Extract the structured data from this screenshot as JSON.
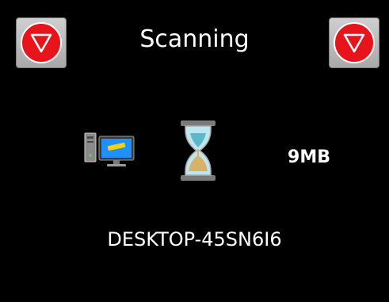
{
  "header": {
    "title": "Scanning",
    "left_button_icon": "stop-sign-icon",
    "right_button_icon": "stop-sign-icon"
  },
  "status": {
    "computer_icon": "computer-icon",
    "hourglass_icon": "hourglass-icon",
    "size": "9MB",
    "device_name": "DESKTOP-45SN6I6"
  },
  "colors": {
    "background": "#000000",
    "text": "#ffffff",
    "stop_red": "#e8141c",
    "button_gray": "#bdbdbd"
  }
}
